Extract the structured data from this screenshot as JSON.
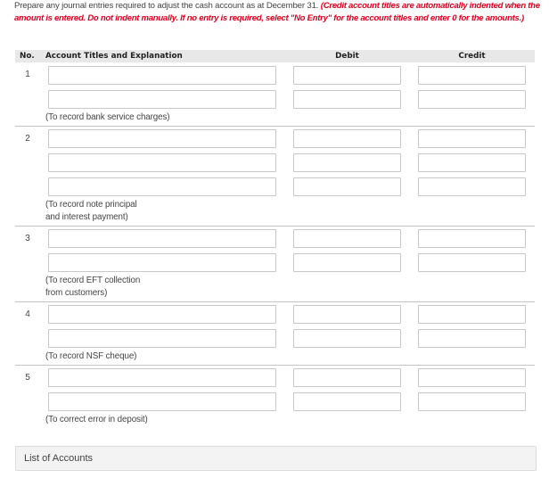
{
  "instructions": {
    "text": "Prepare any journal entries required to adjust the cash account as at December 31.",
    "note": "(Credit account titles are automatically indented when the amount is entered. Do not indent manually. If no entry is required, select \"No Entry\" for the account titles and enter 0 for the amounts.)"
  },
  "table": {
    "headers": {
      "no": "No.",
      "account": "Account Titles and Explanation",
      "debit": "Debit",
      "credit": "Credit"
    },
    "entries": [
      {
        "number": "1",
        "lines": [
          {
            "account": "",
            "debit": "",
            "credit": ""
          },
          {
            "account": "",
            "debit": "",
            "credit": ""
          }
        ],
        "explanation": [
          "(To record bank service charges)"
        ]
      },
      {
        "number": "2",
        "lines": [
          {
            "account": "",
            "debit": "",
            "credit": ""
          },
          {
            "account": "",
            "debit": "",
            "credit": ""
          },
          {
            "account": "",
            "debit": "",
            "credit": ""
          }
        ],
        "explanation": [
          "(To record note principal",
          "and interest payment)"
        ]
      },
      {
        "number": "3",
        "lines": [
          {
            "account": "",
            "debit": "",
            "credit": ""
          },
          {
            "account": "",
            "debit": "",
            "credit": ""
          }
        ],
        "explanation": [
          "(To record EFT collection",
          "from customers)"
        ]
      },
      {
        "number": "4",
        "lines": [
          {
            "account": "",
            "debit": "",
            "credit": ""
          },
          {
            "account": "",
            "debit": "",
            "credit": ""
          }
        ],
        "explanation": [
          "(To record NSF cheque)"
        ]
      },
      {
        "number": "5",
        "lines": [
          {
            "account": "",
            "debit": "",
            "credit": ""
          },
          {
            "account": "",
            "debit": "",
            "credit": ""
          }
        ],
        "explanation": [
          "(To correct error in deposit)"
        ]
      }
    ]
  },
  "list_of_accounts": {
    "label": "List of Accounts"
  },
  "colors": {
    "note_red": "#e0001b",
    "header_bg": "#e8e8e8",
    "panel_bg": "#f3f3f3"
  }
}
